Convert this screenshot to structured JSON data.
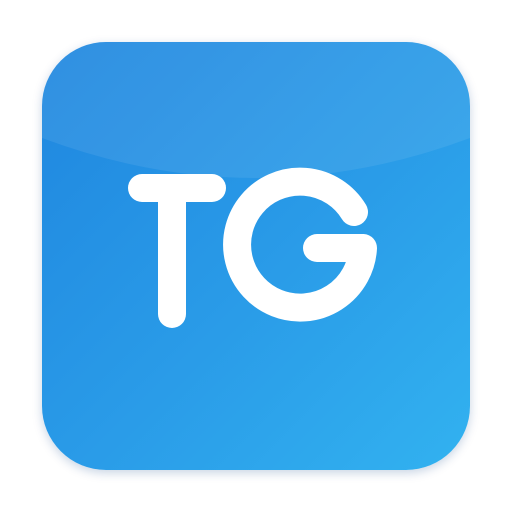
{
  "app_icon": {
    "monogram": "TG",
    "colors": {
      "gradient_start": "#1f86df",
      "gradient_mid": "#2a9ce8",
      "gradient_end": "#32b2f0",
      "glyph": "#ffffff"
    }
  }
}
